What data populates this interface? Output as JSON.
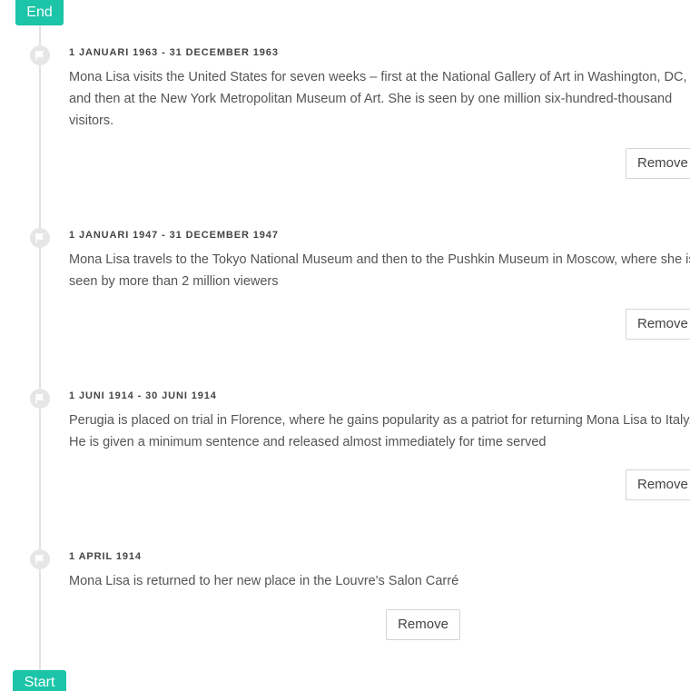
{
  "timeline": {
    "end_label": "End",
    "start_label": "Start",
    "events": [
      {
        "date": "1 JANUARI 1963 - 31 DECEMBER 1963",
        "description": "Mona Lisa visits the United States for seven weeks – first at the National Gallery of Art in Washington, DC, and then at the New York Metropolitan Museum of Art. She is seen by one million six-hundred-thousand visitors.",
        "remove_label": "Remove"
      },
      {
        "date": "1 JANUARI 1947 - 31 DECEMBER 1947",
        "description": "Mona Lisa travels to the Tokyo National Museum and then to the Pushkin Museum in Moscow, where she is seen by more than 2 million viewers",
        "remove_label": "Remove"
      },
      {
        "date": "1 JUNI 1914 - 30 JUNI 1914",
        "description": "Perugia is placed on trial in Florence, where he gains popularity as a patriot for returning Mona Lisa to Italy. He is given a minimum sentence and released almost immediately for time served",
        "remove_label": "Remove"
      },
      {
        "date": "1 APRIL 1914",
        "description": "Mona Lisa is returned to her new place in the Louvre's Salon Carré",
        "remove_label": "Remove"
      }
    ]
  },
  "colors": {
    "accent": "#1cc4a8",
    "line": "#e2e2e2",
    "marker": "#e6e6e6",
    "text": "#555555"
  },
  "icons": {
    "marker": "flag-icon"
  }
}
